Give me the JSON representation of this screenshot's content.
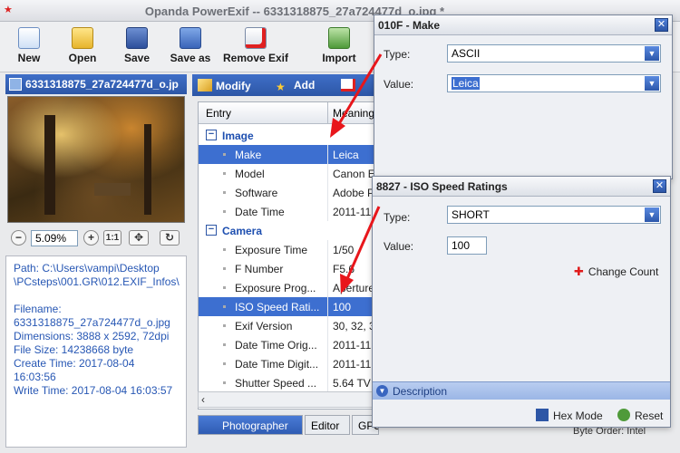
{
  "window": {
    "title": "Opanda PowerExif -- 6331318875_27a724477d_o.jpg *"
  },
  "toolbar": [
    {
      "label": "New",
      "icon": "new-document-icon"
    },
    {
      "label": "Open",
      "icon": "open-folder-icon"
    },
    {
      "label": "Save",
      "icon": "save-disk-icon"
    },
    {
      "label": "Save as",
      "icon": "save-as-icon"
    },
    {
      "label": "Remove Exif",
      "icon": "remove-exif-icon"
    },
    {
      "label": "Import",
      "icon": "import-icon"
    }
  ],
  "image_panel": {
    "filename": "6331318875_27a724477d_o.jp",
    "zoom": "5.09%",
    "zoom_reset": "1:1"
  },
  "info_text": "Path: C:\\Users\\vampi\\Desktop\n\\PCsteps\\001.GR\\012.EXIF_Infos\\\n\nFilename:\n6331318875_27a724477d_o.jpg\nDimensions: 3888 x 2592, 72dpi\nFile Size: 14238668 byte\nCreate Time: 2017-08-04\n16:03:56\nWrite Time: 2017-08-04 16:03:57",
  "sub_toolbar": {
    "modify": "Modify",
    "add": "Add"
  },
  "tree": {
    "col_entry": "Entry",
    "col_meaning": "Meaning",
    "rows": [
      {
        "type": "group",
        "key": "Image",
        "value": ""
      },
      {
        "type": "item",
        "key": "Make",
        "value": "Leica",
        "selected": true
      },
      {
        "type": "item",
        "key": "Model",
        "value": "Canon E"
      },
      {
        "type": "item",
        "key": "Software",
        "value": "Adobe P"
      },
      {
        "type": "item",
        "key": "Date Time",
        "value": "2011-11"
      },
      {
        "type": "group",
        "key": "Camera",
        "value": ""
      },
      {
        "type": "item",
        "key": "Exposure Time",
        "value": "1/50"
      },
      {
        "type": "item",
        "key": "F Number",
        "value": "F5.6"
      },
      {
        "type": "item",
        "key": "Exposure Prog...",
        "value": "Aperture"
      },
      {
        "type": "item",
        "key": "ISO Speed Rati...",
        "value": "100",
        "selected": true
      },
      {
        "type": "item",
        "key": "Exif Version",
        "value": "30, 32, 3"
      },
      {
        "type": "item",
        "key": "Date Time Orig...",
        "value": "2011-11"
      },
      {
        "type": "item",
        "key": "Date Time Digit...",
        "value": "2011-11"
      },
      {
        "type": "item",
        "key": "Shutter Speed ...",
        "value": "5.64 TV"
      }
    ]
  },
  "bottom_tabs": [
    "Photographer",
    "Editor",
    "GPS"
  ],
  "status_right": "Byte Order: Intel",
  "dialog_make": {
    "title": "010F - Make",
    "type_label": "Type:",
    "type_value": "ASCII",
    "value_label": "Value:",
    "value_value": "Leica"
  },
  "dialog_iso": {
    "title": "8827 - ISO Speed Ratings",
    "type_label": "Type:",
    "type_value": "SHORT",
    "value_label": "Value:",
    "value_value": "100",
    "change_count": "Change Count",
    "description": "Description",
    "hex_mode": "Hex Mode",
    "reset": "Reset"
  },
  "colors": {
    "accent": "#2d56a6",
    "selection": "#3d6fd0",
    "arrow": "#e8161b"
  }
}
